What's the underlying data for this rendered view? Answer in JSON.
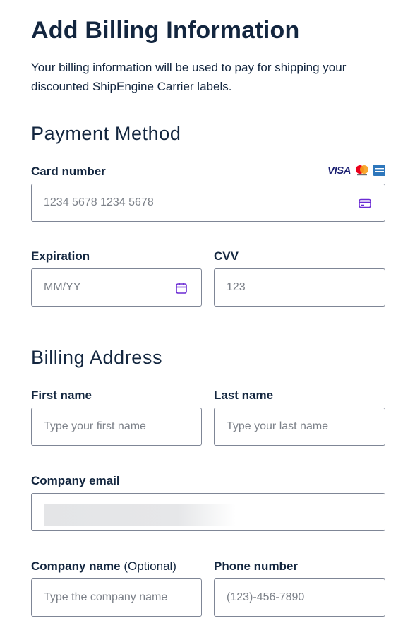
{
  "header": {
    "title": "Add Billing Information",
    "subtitle": "Your billing information will be used to pay for shipping your discounted ShipEngine Carrier labels."
  },
  "payment": {
    "section_title": "Payment Method",
    "card_number": {
      "label": "Card number",
      "placeholder": "1234 5678 1234 5678",
      "value": ""
    },
    "card_brands": {
      "visa_text": "VISA",
      "icons": [
        "visa-logo",
        "mastercard-logo",
        "amex-logo"
      ]
    },
    "expiration": {
      "label": "Expiration",
      "placeholder": "MM/YY",
      "value": ""
    },
    "cvv": {
      "label": "CVV",
      "placeholder": "123",
      "value": ""
    }
  },
  "billing": {
    "section_title": "Billing Address",
    "first_name": {
      "label": "First name",
      "placeholder": "Type your first name",
      "value": ""
    },
    "last_name": {
      "label": "Last name",
      "placeholder": "Type your last name",
      "value": ""
    },
    "company_email": {
      "label": "Company email",
      "value_redacted": true
    },
    "company_name": {
      "label": "Company name",
      "optional_text": "(Optional)",
      "placeholder": "Type the company name",
      "value": ""
    },
    "phone": {
      "label": "Phone number",
      "placeholder": "(123)-456-7890",
      "value": ""
    }
  },
  "colors": {
    "text": "#13263f",
    "border": "#7f8696",
    "placeholder": "#7c8189",
    "accent_icon": "#6b2bd4",
    "visa": "#1a1f71",
    "mastercard_red": "#eb001b",
    "mastercard_yellow": "#f79e1b",
    "amex": "#2e77bc"
  }
}
